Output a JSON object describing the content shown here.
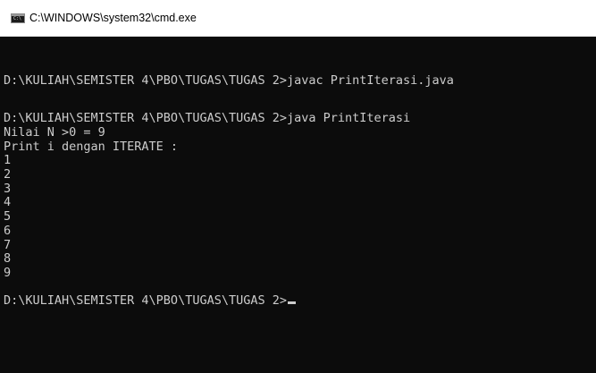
{
  "window": {
    "title": "C:\\WINDOWS\\system32\\cmd.exe",
    "icon_label": "C:\\"
  },
  "console": {
    "lines": [
      "D:\\KULIAH\\SEMISTER 4\\PBO\\TUGAS\\TUGAS 2>javac PrintIterasi.java",
      "D:\\KULIAH\\SEMISTER 4\\PBO\\TUGAS\\TUGAS 2>java PrintIterasi",
      "Nilai N >0 = 9",
      "Print i dengan ITERATE :",
      "1",
      "2",
      "3",
      "4",
      "5",
      "6",
      "7",
      "8",
      "9"
    ],
    "prompt": "D:\\KULIAH\\SEMISTER 4\\PBO\\TUGAS\\TUGAS 2>"
  },
  "colors": {
    "console_background": "#0c0c0c",
    "console_text": "#cccccc",
    "titlebar_background": "#ffffff"
  }
}
